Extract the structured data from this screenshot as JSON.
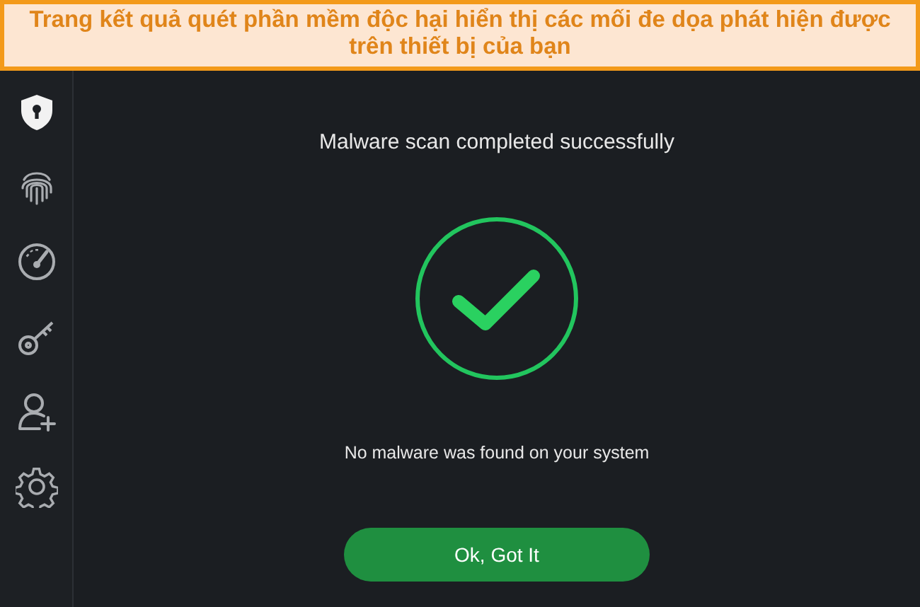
{
  "banner": {
    "text": "Trang kết quả quét phần mềm độc hại hiển thị các mối đe dọa phát hiện được trên thiết bị của bạn"
  },
  "sidebar": {
    "items": [
      {
        "kind": "shield",
        "selected": true
      },
      {
        "kind": "fingerprint",
        "selected": false
      },
      {
        "kind": "gauge",
        "selected": false
      },
      {
        "kind": "key",
        "selected": false
      },
      {
        "kind": "add-user",
        "selected": false
      },
      {
        "kind": "gear",
        "selected": false
      }
    ]
  },
  "main": {
    "title": "Malware scan completed successfully",
    "message": "No malware was found on your system",
    "button": "Ok, Got It"
  }
}
